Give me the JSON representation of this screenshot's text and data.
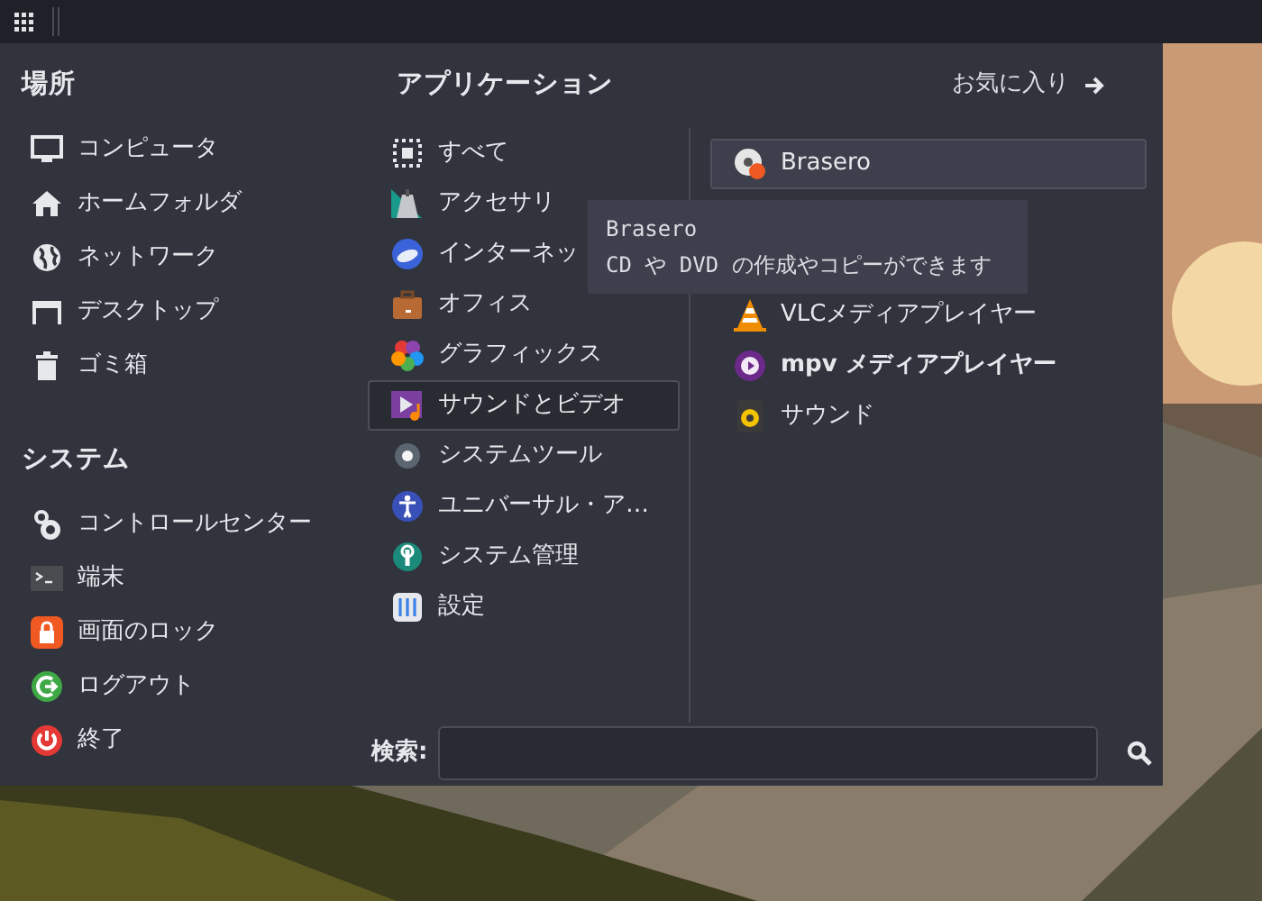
{
  "places": {
    "title": "場所",
    "items": [
      {
        "label": "コンピュータ"
      },
      {
        "label": "ホームフォルダ"
      },
      {
        "label": "ネットワーク"
      },
      {
        "label": "デスクトップ"
      },
      {
        "label": "ゴミ箱"
      }
    ]
  },
  "system": {
    "title": "システム",
    "items": [
      {
        "label": "コントロールセンター"
      },
      {
        "label": "端末"
      },
      {
        "label": "画面のロック"
      },
      {
        "label": "ログアウト"
      },
      {
        "label": "終了"
      }
    ]
  },
  "applications": {
    "title": "アプリケーション",
    "favorites": "お気に入り",
    "categories": [
      {
        "label": "すべて",
        "selected": false
      },
      {
        "label": "アクセサリ",
        "selected": false
      },
      {
        "label": "インターネッ",
        "selected": false
      },
      {
        "label": "オフィス",
        "selected": false
      },
      {
        "label": "グラフィックス",
        "selected": false
      },
      {
        "label": "サウンドとビデオ",
        "selected": true
      },
      {
        "label": "システムツール",
        "selected": false
      },
      {
        "label": "ユニバーサル・ア…",
        "selected": false
      },
      {
        "label": "システム管理",
        "selected": false
      },
      {
        "label": "設定",
        "selected": false
      }
    ],
    "apps": [
      {
        "label": "Brasero",
        "selected": true,
        "new": false
      },
      {
        "label": "VLCメディアプレイヤー",
        "selected": false,
        "new": false
      },
      {
        "label": "mpv メディアプレイヤー",
        "selected": false,
        "new": true
      },
      {
        "label": "サウンド",
        "selected": false,
        "new": false
      }
    ]
  },
  "tooltip": {
    "title": "Brasero",
    "description": "CD や DVD の作成やコピーができます"
  },
  "search": {
    "label": "検索:"
  }
}
